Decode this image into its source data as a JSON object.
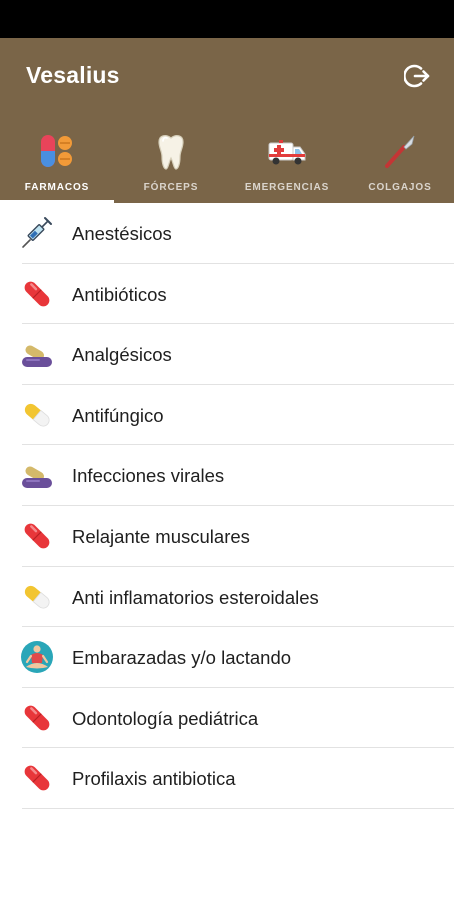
{
  "app": {
    "title": "Vesalius",
    "logout_icon": "logout-icon",
    "header_color": "#7a6548"
  },
  "tabs": [
    {
      "label": "FARMACOS",
      "icon": "pills-icon",
      "active": true
    },
    {
      "label": "FÓRCEPS",
      "icon": "tooth-icon",
      "active": false
    },
    {
      "label": "EMERGENCIAS",
      "icon": "ambulance-icon",
      "active": false
    },
    {
      "label": "COLGAJOS",
      "icon": "scalpel-icon",
      "active": false
    }
  ],
  "items": [
    {
      "label": "Anestésicos",
      "icon": "syringe-icon"
    },
    {
      "label": "Antibióticos",
      "icon": "red-pill-icon"
    },
    {
      "label": "Analgésicos",
      "icon": "purple-capsule-icon"
    },
    {
      "label": "Antifúngico",
      "icon": "yellow-pill-icon"
    },
    {
      "label": "Infecciones virales",
      "icon": "purple-capsule-icon"
    },
    {
      "label": "Relajante musculares",
      "icon": "red-pill-icon"
    },
    {
      "label": "Anti inflamatorios esteroidales",
      "icon": "yellow-pill-icon"
    },
    {
      "label": "Embarazadas y/o lactando",
      "icon": "meditation-icon"
    },
    {
      "label": "Odontología pediátrica",
      "icon": "red-pill-icon"
    },
    {
      "label": "Profilaxis antibiotica",
      "icon": "red-pill-icon"
    }
  ]
}
